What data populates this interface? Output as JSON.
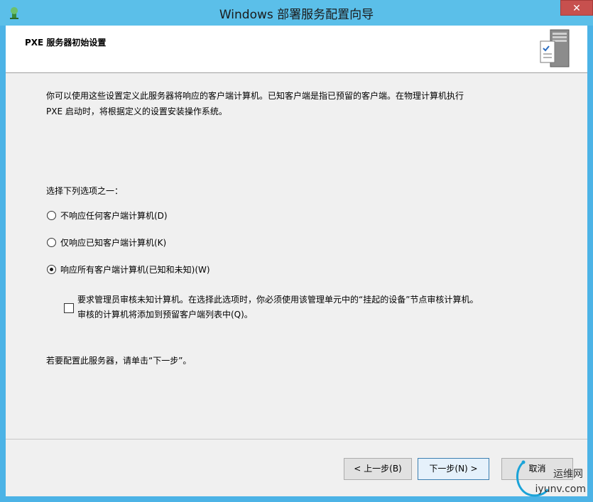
{
  "window": {
    "title": "Windows 部署服务配置向导",
    "close_label": "✕"
  },
  "header": {
    "title": "PXE 服务器初始设置",
    "icon": "server-checklist-icon"
  },
  "intro": {
    "line1": "你可以使用这些设置定义此服务器将响应的客户端计算机。已知客户端是指已预留的客户端。在物理计算机执行",
    "line2": "PXE 启动时，将根据定义的设置安装操作系统。"
  },
  "choose_label": "选择下列选项之一：",
  "options": [
    {
      "label": "不响应任何客户端计算机(D)",
      "checked": false
    },
    {
      "label": "仅响应已知客户端计算机(K)",
      "checked": false
    },
    {
      "label": "响应所有客户端计算机(已知和未知)(W)",
      "checked": true
    }
  ],
  "approval_checkbox": {
    "line1": "要求管理员审核未知计算机。在选择此选项时，你必须使用该管理单元中的“挂起的设备”节点审核计算机。",
    "line2": "审核的计算机将添加到预留客户端列表中(Q)。",
    "checked": false
  },
  "footer_text": "若要配置此服务器，请单击“下一步”。",
  "buttons": {
    "back": "< 上一步(B)",
    "next": "下一步(N) >",
    "cancel": "取消"
  },
  "watermark": {
    "line1": "运维网",
    "line2": "iyunv.com"
  }
}
